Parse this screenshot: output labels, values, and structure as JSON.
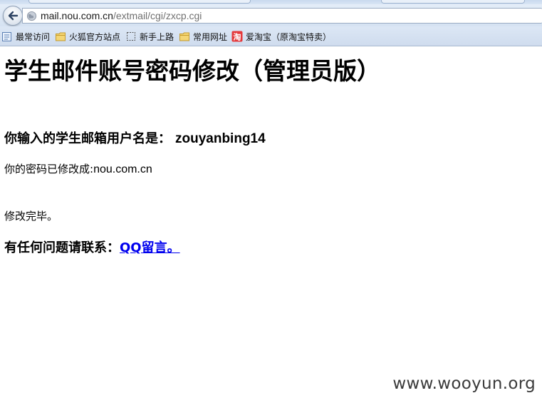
{
  "browser": {
    "url_host": "mail.nou.com.cn",
    "url_path": "/extmail/cgi/zxcp.cgi",
    "bookmarks": [
      {
        "label": "最常访问",
        "icon": "bookmark-list-icon"
      },
      {
        "label": "火狐官方站点",
        "icon": "folder-icon"
      },
      {
        "label": "新手上路",
        "icon": "dashed-page-icon"
      },
      {
        "label": "常用网址",
        "icon": "folder-icon"
      },
      {
        "label": "爱淘宝（原淘宝特卖）",
        "icon": "taobao-icon",
        "icon_glyph": "淘",
        "icon_color": "#e4393c"
      }
    ]
  },
  "page": {
    "title": "学生邮件账号密码修改（管理员版）",
    "username_label": "你输入的学生邮箱用户名是：",
    "username_value": "zouyanbing14",
    "password_label": "你的密码已修改成:",
    "password_value": "nou.com.cn",
    "done_text": "修改完毕。",
    "contact_label": "有任何问题请联系：",
    "contact_link": "QQ留言。"
  },
  "watermark": "www.wooyun.org",
  "colors": {
    "link": "#0000ee",
    "chrome_bg": "#d5e2f2",
    "taobao_red": "#e4393c"
  }
}
